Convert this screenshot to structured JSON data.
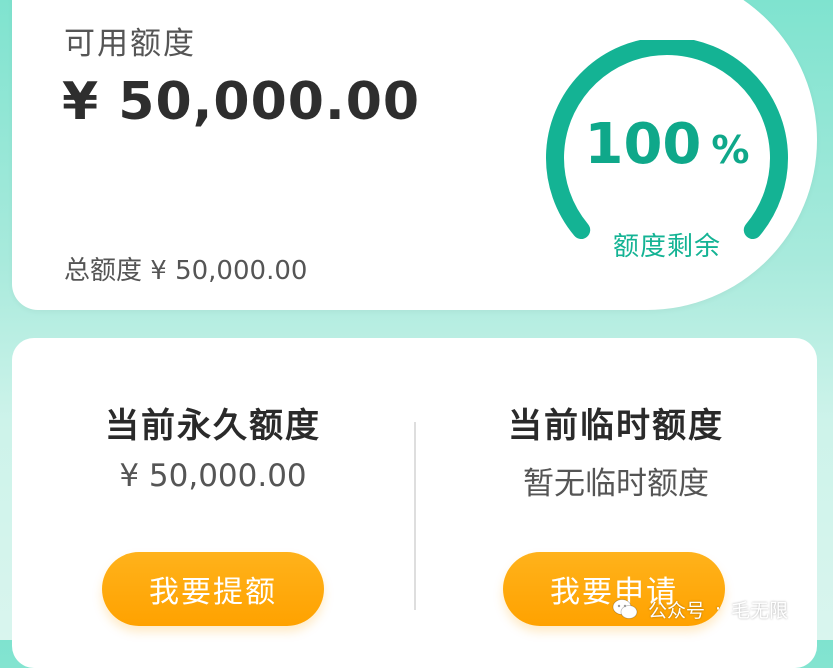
{
  "credit": {
    "available_label": "可用额度",
    "available_amount": "¥ 50,000.00",
    "total_label": "总额度",
    "total_amount": "¥ 50,000.00",
    "gauge": {
      "value": "100",
      "unit": "%",
      "remaining_fraction": 1.0,
      "caption": "额度剩余",
      "color": "#14b394"
    }
  },
  "quota": {
    "permanent": {
      "title": "当前永久额度",
      "value": "¥ 50,000.00",
      "button_label": "我要提额"
    },
    "temporary": {
      "title": "当前临时额度",
      "value": "暂无临时额度",
      "button_label": "我要申请"
    }
  },
  "watermark": {
    "icon": "wechat-icon",
    "source": "公众号",
    "separator": "·",
    "author": "毛无限"
  },
  "colors": {
    "accent": "#14b394",
    "button": "#ffa200",
    "background_top": "#7fe3cf",
    "background_bottom": "#d9f5ee"
  }
}
